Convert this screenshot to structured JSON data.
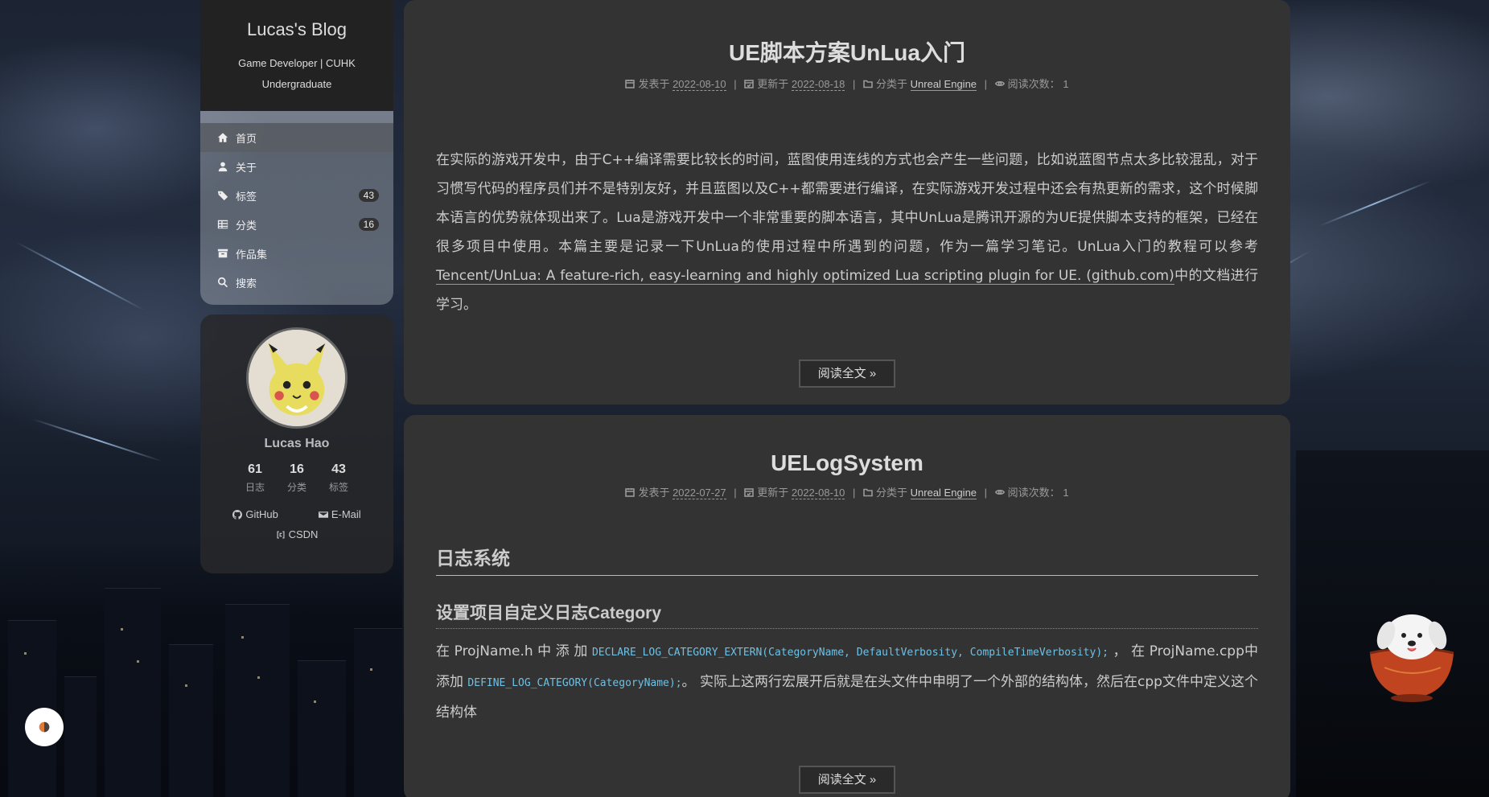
{
  "site": {
    "title": "Lucas's Blog",
    "subtitle": "Game Developer | CUHK Undergraduate"
  },
  "menu": [
    {
      "label": "首页",
      "icon": "home-icon",
      "active": true
    },
    {
      "label": "关于",
      "icon": "user-icon"
    },
    {
      "label": "标签",
      "icon": "tags-icon",
      "badge": "43"
    },
    {
      "label": "分类",
      "icon": "th-icon",
      "badge": "16"
    },
    {
      "label": "作品集",
      "icon": "archive-icon"
    },
    {
      "label": "搜索",
      "icon": "search-icon"
    }
  ],
  "profile": {
    "name": "Lucas Hao",
    "stats": [
      {
        "num": "61",
        "label": "日志"
      },
      {
        "num": "16",
        "label": "分类"
      },
      {
        "num": "43",
        "label": "标签"
      }
    ],
    "links": {
      "github": "GitHub",
      "email": "E-Mail",
      "csdn": "CSDN"
    }
  },
  "posts": [
    {
      "title": "UE脚本方案UnLua入门",
      "meta": {
        "published_label": "发表于",
        "published": "2022-08-10",
        "updated_label": "更新于",
        "updated": "2022-08-18",
        "category_label": "分类于",
        "category": "Unreal Engine",
        "views_label": "阅读次数：",
        "views": "1"
      },
      "body_text": "在实际的游戏开发中，由于C++编译需要比较长的时间，蓝图使用连线的方式也会产生一些问题，比如说蓝图节点太多比较混乱，对于习惯写代码的程序员们并不是特别友好，并且蓝图以及C++都需要进行编译，在实际游戏开发过程中还会有热更新的需求，这个时候脚本语言的优势就体现出来了。Lua是游戏开发中一个非常重要的脚本语言，其中UnLua是腾讯开源的为UE提供脚本支持的框架，已经在很多项目中使用。本篇主要是记录一下UnLua的使用过程中所遇到的问题，作为一篇学习笔记。UnLua入门的教程可以参考 ",
      "body_link": "Tencent/UnLua: A feature-rich, easy-learning and highly optimized Lua scripting plugin for UE. (github.com)",
      "body_tail": "中的文档进行学习。",
      "read_more": "阅读全文 »"
    },
    {
      "title": "UELogSystem",
      "meta": {
        "published_label": "发表于",
        "published": "2022-07-27",
        "updated_label": "更新于",
        "updated": "2022-08-10",
        "category_label": "分类于",
        "category": "Unreal Engine",
        "views_label": "阅读次数：",
        "views": "1"
      },
      "h2": "日志系统",
      "h3": "设置项目自定义日志Category",
      "p_a": "在 ProjName.h 中 添 加 ",
      "code_a": "DECLARE_LOG_CATEGORY_EXTERN(CategoryName, DefaultVerbosity, CompileTimeVerbosity);",
      "p_b": " ， 在 ProjName.cpp中添加 ",
      "code_b": "DEFINE_LOG_CATEGORY(CategoryName);",
      "p_c": "。 实际上这两行宏展开后就是在头文件中申明了一个外部的结构体，然后在cpp文件中定义这个结构体",
      "read_more": "阅读全文 »"
    }
  ]
}
